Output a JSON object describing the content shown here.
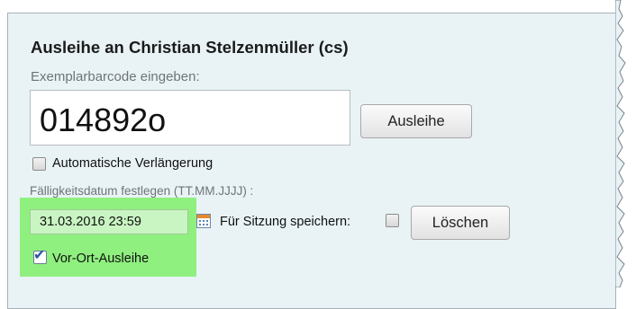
{
  "loan": {
    "title": "Ausleihe an Christian Stelzenmüller (cs)",
    "barcode_label": "Exemplarbarcode eingeben:",
    "barcode_value": "014892o",
    "loan_button": "Ausleihe",
    "auto_renew_label": "Automatische Verlängerung",
    "auto_renew_checked": false,
    "due_date_label": "Fälligkeitsdatum festlegen (TT.MM.JJJJ) :",
    "due_date_value": "31.03.2016 23:59",
    "save_session_label": "Für Sitzung speichern:",
    "save_session_checked": false,
    "delete_button": "Löschen",
    "onsite_label": "Vor-Ort-Ausleihe",
    "onsite_checked": true
  },
  "colors": {
    "panel_background": "#e9f3f6",
    "highlight": "#8ff07f",
    "date_field_background": "#c9f5c2"
  },
  "icons": {
    "calendar": "calendar-icon",
    "check": "checkmark-icon"
  }
}
